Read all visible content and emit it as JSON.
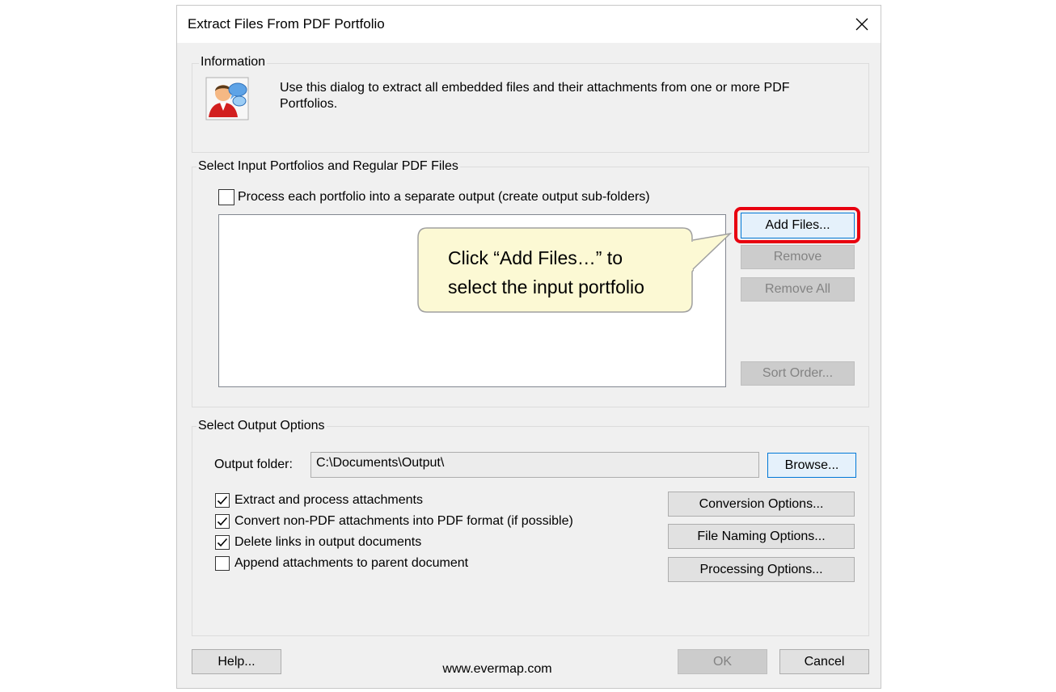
{
  "window": {
    "title": "Extract Files From PDF Portfolio"
  },
  "information": {
    "label": "Information",
    "text": "Use this dialog to extract all embedded files and their attachments from one or more PDF Portfolios."
  },
  "input": {
    "label": "Select Input Portfolios and Regular PDF Files",
    "separate_output_label": "Process each portfolio into a separate output (create output sub-folders)",
    "separate_output_checked": false,
    "buttons": {
      "add_files": "Add Files...",
      "remove": "Remove",
      "remove_all": "Remove All",
      "sort_order": "Sort Order..."
    }
  },
  "callout": {
    "line1": "Click “Add Files…” to",
    "line2": "select the input portfolio"
  },
  "output": {
    "label": "Select Output Options",
    "folder_label": "Output folder:",
    "folder_value": "C:\\Documents\\Output\\",
    "browse": "Browse...",
    "options": [
      {
        "label": "Extract and process attachments",
        "checked": true
      },
      {
        "label": "Convert non-PDF attachments into PDF format (if possible)",
        "checked": true
      },
      {
        "label": "Delete links in output documents",
        "checked": true
      },
      {
        "label": "Append attachments to parent document",
        "checked": false
      }
    ],
    "buttons": {
      "conversion": "Conversion Options...",
      "file_naming": "File Naming Options...",
      "processing": "Processing Options..."
    }
  },
  "footer": {
    "help": "Help...",
    "website": "www.evermap.com",
    "ok": "OK",
    "cancel": "Cancel"
  },
  "colors": {
    "highlight": "#e8000f",
    "callout_fill": "#fcf9d4",
    "callout_border": "#a0a0a0",
    "focus": "#0078d7"
  }
}
